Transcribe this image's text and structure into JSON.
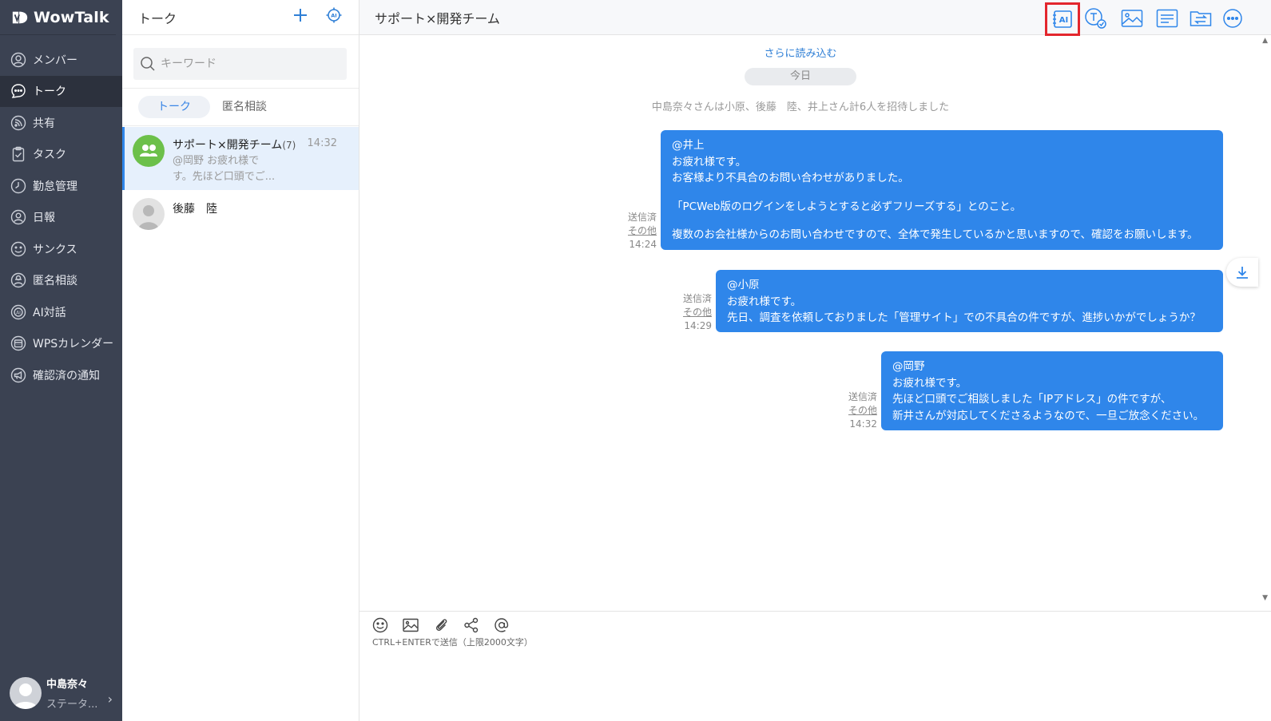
{
  "app": {
    "name": "WowTalk"
  },
  "nav": {
    "items": [
      {
        "label": "メンバー",
        "icon": "user-circle-icon"
      },
      {
        "label": "トーク",
        "icon": "chat-bubble-icon"
      },
      {
        "label": "共有",
        "icon": "rss-icon"
      },
      {
        "label": "タスク",
        "icon": "clipboard-check-icon"
      },
      {
        "label": "勤怠管理",
        "icon": "clock-icon"
      },
      {
        "label": "日報",
        "icon": "user-report-icon"
      },
      {
        "label": "サンクス",
        "icon": "smile-icon"
      },
      {
        "label": "匿名相談",
        "icon": "anonymous-user-icon"
      },
      {
        "label": "AI対話",
        "icon": "ai-chat-icon"
      },
      {
        "label": "WPSカレンダー",
        "icon": "calendar-icon"
      },
      {
        "label": "確認済の通知",
        "icon": "megaphone-icon"
      }
    ],
    "active_index": 1,
    "user": {
      "name": "中島奈々",
      "status": "ステータ..."
    }
  },
  "list": {
    "title": "トーク",
    "search_placeholder": "キーワード",
    "tabs": [
      "トーク",
      "匿名相談"
    ],
    "conversations": [
      {
        "name": "サポート×開発チーム",
        "count": "(7)",
        "time": "14:32",
        "preview": "@岡野 お疲れ様です。先ほど口頭でご..."
      },
      {
        "name": "後藤　陸",
        "count": "",
        "time": "",
        "preview": ""
      }
    ]
  },
  "chat": {
    "title": "サポート×開発チーム",
    "toolbar": [
      "ai-summary-icon",
      "translate-icon",
      "image-gallery-icon",
      "notes-icon",
      "folder-transfer-icon",
      "more-icon"
    ],
    "load_more": "さらに読み込む",
    "date": "今日",
    "system": "中島奈々さんは小原、後藤　陸、井上さん計6人を招待しました",
    "messages": [
      {
        "lines": [
          "@井上",
          "お疲れ様です。",
          "お客様より不具合のお問い合わせがありました。",
          "「PCWeb版のログインをしようとすると必ずフリーズする」とのこと。",
          "複数のお会社様からのお問い合わせですので、全体で発生しているかと思いますので、確認をお願いします。"
        ],
        "status": "送信済",
        "other": "その他",
        "time": "14:24"
      },
      {
        "lines": [
          "@小原",
          "お疲れ様です。",
          "先日、調査を依頼しておりました「管理サイト」での不具合の件ですが、進捗いかがでしょうか？"
        ],
        "status": "送信済",
        "other": "その他",
        "time": "14:29"
      },
      {
        "lines": [
          "@岡野",
          "お疲れ様です。",
          "先ほど口頭でご相談しました「IPアドレス」の件ですが、",
          "新井さんが対応してくださるようなので、一旦ご放念ください。"
        ],
        "status": "送信済",
        "other": "その他",
        "time": "14:32"
      }
    ],
    "composer": {
      "hint": "CTRL+ENTERで送信（上限2000文字）",
      "value": ""
    },
    "colors": {
      "bubble": "#2f86ea",
      "nav": "#3b4252",
      "highlight": "#e3262d"
    }
  }
}
